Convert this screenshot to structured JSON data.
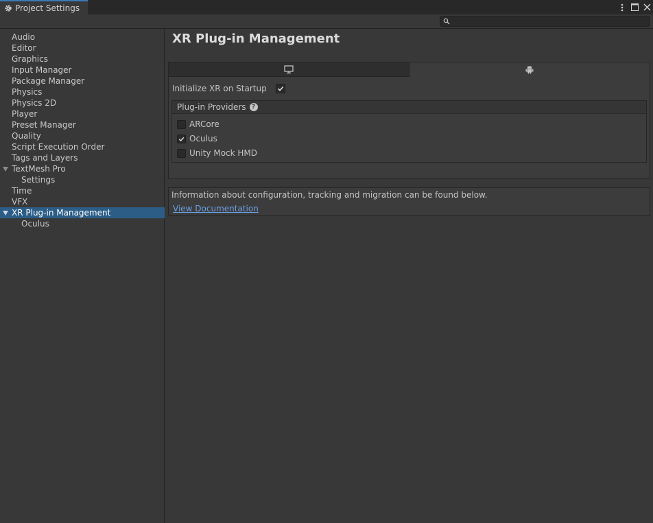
{
  "window": {
    "tab_title": "Project Settings",
    "icons": [
      "gear-icon",
      "kebab-menu-icon",
      "maximize-icon",
      "close-icon"
    ]
  },
  "search": {
    "placeholder": ""
  },
  "sidebar": {
    "items": [
      {
        "label": "Audio"
      },
      {
        "label": "Editor"
      },
      {
        "label": "Graphics"
      },
      {
        "label": "Input Manager"
      },
      {
        "label": "Package Manager"
      },
      {
        "label": "Physics"
      },
      {
        "label": "Physics 2D"
      },
      {
        "label": "Player"
      },
      {
        "label": "Preset Manager"
      },
      {
        "label": "Quality"
      },
      {
        "label": "Script Execution Order"
      },
      {
        "label": "Tags and Layers"
      },
      {
        "label": "TextMesh Pro",
        "expanded": true
      },
      {
        "label": "Settings",
        "child": true
      },
      {
        "label": "Time"
      },
      {
        "label": "VFX"
      },
      {
        "label": "XR Plug-in Management",
        "expanded": true,
        "selected": true
      },
      {
        "label": "Oculus",
        "child": true
      }
    ]
  },
  "main": {
    "title": "XR Plug-in Management",
    "platform_tabs": [
      {
        "name": "desktop-icon",
        "active": false
      },
      {
        "name": "android-icon",
        "active": true
      }
    ],
    "init_label": "Initialize XR on Startup",
    "init_checked": true,
    "providers": {
      "header": "Plug-in Providers",
      "items": [
        {
          "label": "ARCore",
          "checked": false
        },
        {
          "label": "Oculus",
          "checked": true
        },
        {
          "label": "Unity Mock HMD",
          "checked": false
        }
      ]
    },
    "info": {
      "text": "Information about configuration, tracking and migration can be found below.",
      "link": "View Documentation"
    }
  },
  "colors": {
    "background": "#383838",
    "selection": "#2c5d87",
    "link": "#6ca0e6",
    "tab_accent": "#3a79bb"
  }
}
